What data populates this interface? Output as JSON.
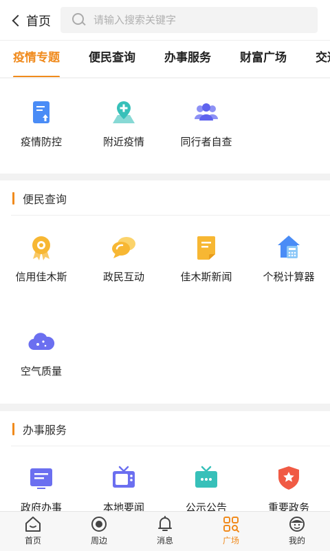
{
  "header": {
    "back_label": "首页",
    "search_placeholder": "请输入搜索关键字"
  },
  "tabs": [
    {
      "label": "疫情专题",
      "active": true
    },
    {
      "label": "便民查询"
    },
    {
      "label": "办事服务"
    },
    {
      "label": "财富广场"
    },
    {
      "label": "交通"
    }
  ],
  "epidemic": {
    "items": [
      {
        "label": "疫情防控",
        "icon": "document-upload-icon"
      },
      {
        "label": "附近疫情",
        "icon": "map-pin-plus-icon"
      },
      {
        "label": "同行者自查",
        "icon": "group-people-icon"
      }
    ]
  },
  "convenience": {
    "title": "便民查询",
    "items": [
      {
        "label": "信用佳木斯",
        "icon": "credit-medal-icon"
      },
      {
        "label": "政民互动",
        "icon": "chat-bubbles-icon"
      },
      {
        "label": "佳木斯新闻",
        "icon": "news-document-icon"
      },
      {
        "label": "个税计算器",
        "icon": "tax-calculator-icon"
      },
      {
        "label": "空气质量",
        "icon": "cloud-icon"
      }
    ]
  },
  "services": {
    "title": "办事服务",
    "items": [
      {
        "label": "政府办事",
        "icon": "government-affairs-icon"
      },
      {
        "label": "本地要闻",
        "icon": "tv-news-icon"
      },
      {
        "label": "公示公告",
        "icon": "notice-board-icon"
      },
      {
        "label": "重要政务",
        "icon": "star-shield-icon"
      }
    ]
  },
  "bottom_nav": [
    {
      "label": "首页",
      "icon": "home-icon"
    },
    {
      "label": "周边",
      "icon": "nearby-circle-icon"
    },
    {
      "label": "消息",
      "icon": "bell-icon"
    },
    {
      "label": "广场",
      "icon": "square-grid-icon",
      "active": true
    },
    {
      "label": "我的",
      "icon": "profile-icon"
    }
  ],
  "colors": {
    "accent": "#f08a1c",
    "blue": "#4a8cf6",
    "yellow": "#f7b733",
    "purple": "#6b6ff0",
    "teal": "#37c0b9",
    "red": "#f05a44"
  }
}
